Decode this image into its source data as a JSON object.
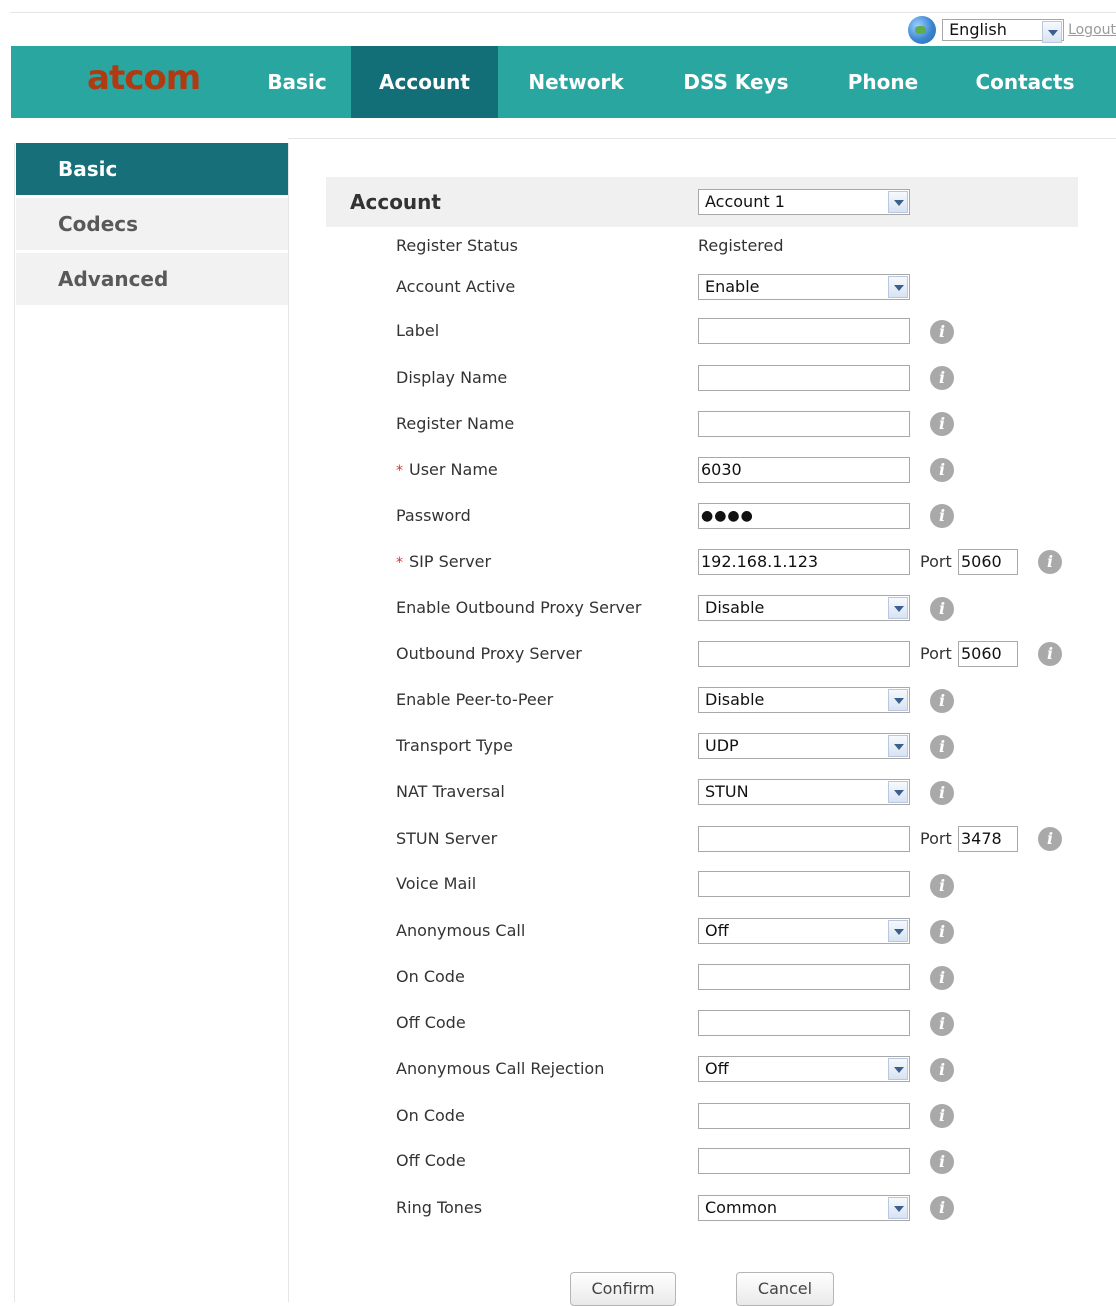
{
  "topbar": {
    "language": "English",
    "logout": "Logout"
  },
  "nav": {
    "logo": "atcom",
    "tabs": [
      {
        "label": "Basic"
      },
      {
        "label": "Account"
      },
      {
        "label": "Network"
      },
      {
        "label": "DSS Keys"
      },
      {
        "label": "Phone"
      },
      {
        "label": "Contacts"
      }
    ]
  },
  "sidebar": {
    "items": [
      {
        "label": "Basic"
      },
      {
        "label": "Codecs"
      },
      {
        "label": "Advanced"
      }
    ]
  },
  "panel": {
    "title": "Account",
    "account_select": "Account 1"
  },
  "form": {
    "register_status": {
      "label": "Register Status",
      "value": "Registered"
    },
    "account_active": {
      "label": "Account Active",
      "value": "Enable"
    },
    "label": {
      "label": "Label",
      "value": ""
    },
    "display_name": {
      "label": "Display Name",
      "value": ""
    },
    "register_name": {
      "label": "Register Name",
      "value": ""
    },
    "user_name": {
      "label": "User Name",
      "value": "6030",
      "required_mark": "*"
    },
    "password": {
      "label": "Password",
      "value": "●●●●"
    },
    "sip_server": {
      "label": "SIP Server",
      "value": "192.168.1.123",
      "required_mark": "*",
      "port_label": "Port",
      "port": "5060"
    },
    "enable_outbound_proxy": {
      "label": "Enable Outbound Proxy Server",
      "value": "Disable"
    },
    "outbound_proxy": {
      "label": "Outbound Proxy Server",
      "value": "",
      "port_label": "Port",
      "port": "5060"
    },
    "enable_p2p": {
      "label": "Enable Peer-to-Peer",
      "value": "Disable"
    },
    "transport_type": {
      "label": "Transport Type",
      "value": "UDP"
    },
    "nat_traversal": {
      "label": "NAT Traversal",
      "value": "STUN"
    },
    "stun_server": {
      "label": "STUN Server",
      "value": "",
      "port_label": "Port",
      "port": "3478"
    },
    "voice_mail": {
      "label": "Voice Mail",
      "value": ""
    },
    "anonymous_call": {
      "label": "Anonymous Call",
      "value": "Off"
    },
    "anon_on_code": {
      "label": "On Code",
      "value": ""
    },
    "anon_off_code": {
      "label": "Off Code",
      "value": ""
    },
    "anon_rejection": {
      "label": "Anonymous Call Rejection",
      "value": "Off"
    },
    "rej_on_code": {
      "label": "On Code",
      "value": ""
    },
    "rej_off_code": {
      "label": "Off Code",
      "value": ""
    },
    "ring_tones": {
      "label": "Ring Tones",
      "value": "Common"
    }
  },
  "buttons": {
    "confirm": "Confirm",
    "cancel": "Cancel"
  },
  "icons": {
    "info": "info-icon",
    "language": "globe-icon"
  },
  "colors": {
    "nav_bg": "#2aa6a1",
    "nav_active": "#126f78",
    "sidebar_active": "#166f79",
    "logo": "#b03a12",
    "required": "#e03030"
  }
}
